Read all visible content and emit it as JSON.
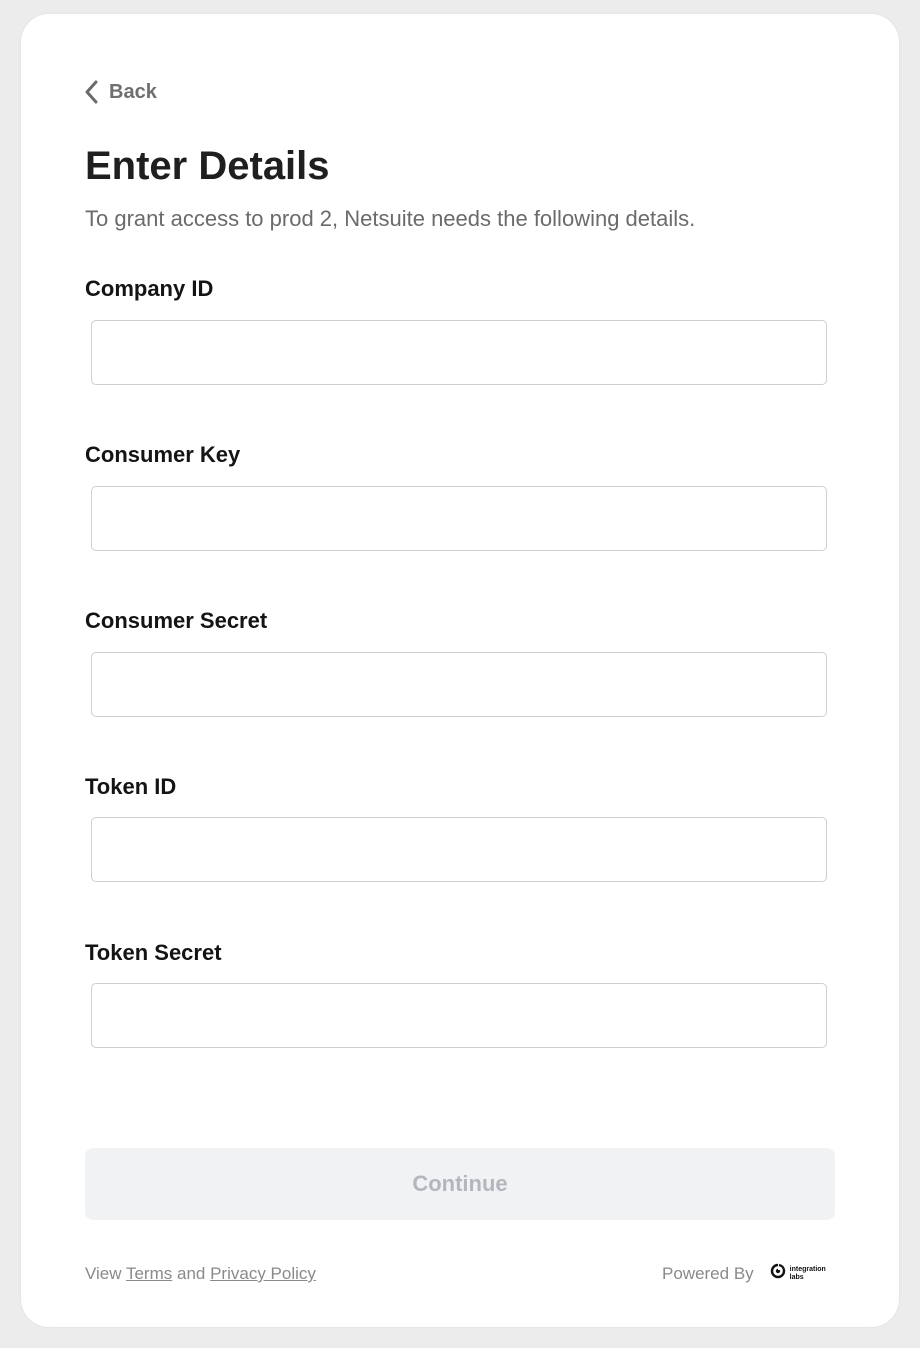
{
  "back": {
    "label": "Back",
    "icon": "chevron-left-icon"
  },
  "header": {
    "title": "Enter Details",
    "subtitle": "To grant access to prod 2, Netsuite needs the following details."
  },
  "fields": [
    {
      "label": "Company ID",
      "value": ""
    },
    {
      "label": "Consumer Key",
      "value": ""
    },
    {
      "label": "Consumer Secret",
      "value": ""
    },
    {
      "label": "Token ID",
      "value": ""
    },
    {
      "label": "Token Secret",
      "value": ""
    }
  ],
  "actions": {
    "continue_label": "Continue"
  },
  "footer": {
    "view": "View",
    "terms": "Terms",
    "and": "and",
    "privacy": "Privacy Policy",
    "powered_by": "Powered By",
    "brand_line1": "integration",
    "brand_line2": "labs"
  },
  "colors": {
    "background": "#ececec",
    "card": "#ffffff",
    "button_disabled_bg": "#f1f2f4",
    "button_disabled_text": "#b3b6bc"
  }
}
